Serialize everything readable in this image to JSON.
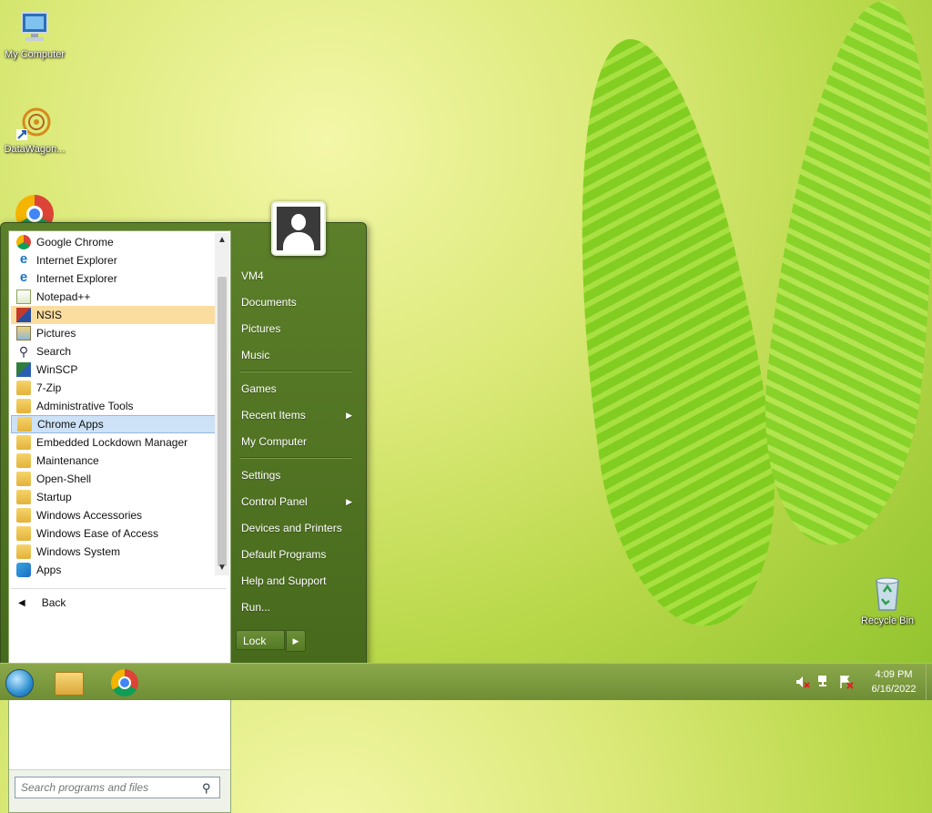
{
  "desktop": {
    "icons": [
      {
        "label": "My Computer"
      },
      {
        "label": "DataWagon..."
      },
      {
        "label": ""
      },
      {
        "label": "Recycle Bin"
      }
    ]
  },
  "start_menu": {
    "programs": [
      {
        "label": "Google Chrome",
        "icon": "chrome-icon"
      },
      {
        "label": "Internet Explorer",
        "icon": "internet-explorer-icon"
      },
      {
        "label": "Internet Explorer",
        "icon": "internet-explorer-icon"
      },
      {
        "label": "Notepad++",
        "icon": "notepad-icon"
      },
      {
        "label": "NSIS",
        "icon": "nsis-icon",
        "highlight": "orange"
      },
      {
        "label": "Pictures",
        "icon": "pictures-icon"
      },
      {
        "label": "Search",
        "icon": "search-icon"
      },
      {
        "label": "WinSCP",
        "icon": "winscp-icon"
      },
      {
        "label": "7-Zip",
        "icon": "folder-icon"
      },
      {
        "label": "Administrative Tools",
        "icon": "folder-icon"
      },
      {
        "label": "Chrome Apps",
        "icon": "folder-icon",
        "highlight": "blue"
      },
      {
        "label": "Embedded Lockdown Manager",
        "icon": "folder-icon"
      },
      {
        "label": "Maintenance",
        "icon": "folder-icon"
      },
      {
        "label": "Open-Shell",
        "icon": "folder-icon"
      },
      {
        "label": "Startup",
        "icon": "folder-icon"
      },
      {
        "label": "Windows Accessories",
        "icon": "folder-icon"
      },
      {
        "label": "Windows Ease of Access",
        "icon": "folder-icon"
      },
      {
        "label": "Windows System",
        "icon": "folder-icon"
      },
      {
        "label": "Apps",
        "icon": "apps-icon"
      }
    ],
    "back_label": "Back",
    "search_placeholder": "Search programs and files",
    "right_items": [
      {
        "label": "VM4"
      },
      {
        "label": "Documents"
      },
      {
        "label": "Pictures"
      },
      {
        "label": "Music"
      },
      {
        "label": "Games"
      },
      {
        "label": "Recent Items",
        "submenu": true
      },
      {
        "label": "My Computer"
      },
      {
        "label": "Settings"
      },
      {
        "label": "Control Panel",
        "submenu": true
      },
      {
        "label": "Devices and Printers"
      },
      {
        "label": "Default Programs"
      },
      {
        "label": "Help and Support"
      },
      {
        "label": "Run..."
      }
    ],
    "lock_label": "Lock"
  },
  "taskbar": {
    "clock": {
      "time": "4:09 PM",
      "date": "6/16/2022"
    }
  },
  "colors": {
    "menu_bg": "#5c7f2a",
    "highlight_orange": "#fcdda0",
    "highlight_blue": "#cde2f7",
    "taskbar": "#7f9c40"
  }
}
